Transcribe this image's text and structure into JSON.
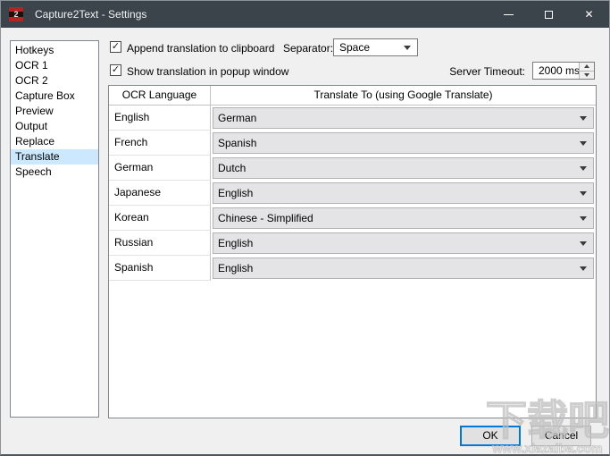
{
  "window": {
    "title": "Capture2Text - Settings",
    "icon_text": "2",
    "close_icon": "✕"
  },
  "sidebar": {
    "items": [
      {
        "label": "Hotkeys",
        "selected": false
      },
      {
        "label": "OCR 1",
        "selected": false
      },
      {
        "label": "OCR 2",
        "selected": false
      },
      {
        "label": "Capture Box",
        "selected": false
      },
      {
        "label": "Preview",
        "selected": false
      },
      {
        "label": "Output",
        "selected": false
      },
      {
        "label": "Replace",
        "selected": false
      },
      {
        "label": "Translate",
        "selected": true
      },
      {
        "label": "Speech",
        "selected": false
      }
    ]
  },
  "options": {
    "append_clipboard": {
      "label": "Append translation to clipboard",
      "checked": true,
      "check_glyph": "✓"
    },
    "separator": {
      "label": "Separator:",
      "value": "Space"
    },
    "show_popup": {
      "label": "Show translation in popup window",
      "checked": true,
      "check_glyph": "✓"
    },
    "server_timeout": {
      "label": "Server Timeout:",
      "value": "2000 ms"
    }
  },
  "table": {
    "headers": [
      "OCR Language",
      "Translate To (using Google Translate)"
    ],
    "rows": [
      {
        "ocr_language": "English",
        "translate_to": "German"
      },
      {
        "ocr_language": "French",
        "translate_to": "Spanish"
      },
      {
        "ocr_language": "German",
        "translate_to": "Dutch"
      },
      {
        "ocr_language": "Japanese",
        "translate_to": "English"
      },
      {
        "ocr_language": "Korean",
        "translate_to": "Chinese - Simplified"
      },
      {
        "ocr_language": "Russian",
        "translate_to": "English"
      },
      {
        "ocr_language": "Spanish",
        "translate_to": "English"
      }
    ]
  },
  "buttons": {
    "ok": "OK",
    "cancel": "Cancel"
  },
  "watermark": {
    "text": "下载吧",
    "url": "www.xiazaiba.com"
  },
  "colors": {
    "titlebar": "#3b434b",
    "dialog_bg": "#f0f0f0",
    "selection": "#cbe8ff",
    "focus_border": "#0078d7"
  }
}
